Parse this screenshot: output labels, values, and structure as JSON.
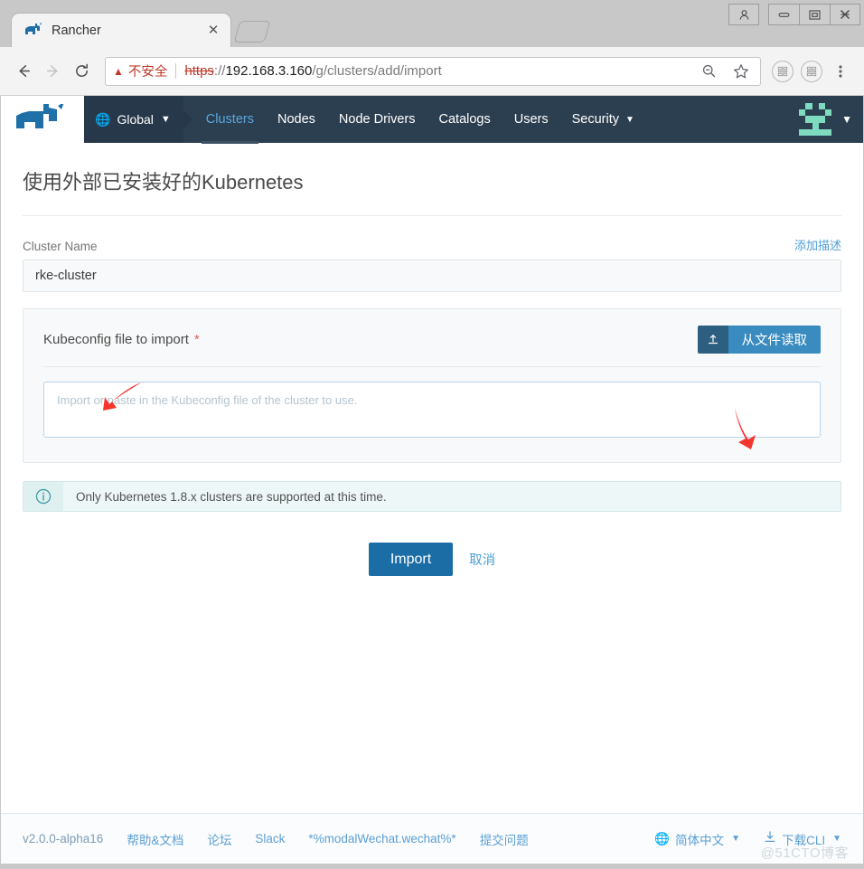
{
  "browser": {
    "tab": {
      "title": "Rancher",
      "favicon_icon": "rancher-favicon",
      "close_icon": "close-icon"
    },
    "new_tab_icon": "new-tab-icon",
    "window_controls": {
      "profile_icon": "person-icon",
      "minimize_icon": "minimize-icon",
      "maximize_icon": "maximize-icon",
      "close_icon": "window-close-icon"
    },
    "toolbar": {
      "back_icon": "back-arrow-icon",
      "forward_icon": "forward-arrow-icon",
      "reload_icon": "reload-icon",
      "security_warning_icon": "warning-triangle-icon",
      "security_warning_text": "不安全",
      "url_scheme": "https",
      "url_scheme_suffix": "://",
      "url_host": "192.168.3.160",
      "url_path": "/g/clusters/add/import",
      "zoom_icon": "zoom-out-icon",
      "bookmark_icon": "star-icon",
      "extension_1_icon": "extension-icon",
      "extension_2_icon": "extension-icon",
      "menu_icon": "three-dot-menu-icon"
    }
  },
  "nav": {
    "logo_icon": "rancher-cow-logo",
    "context": {
      "globe_icon": "globe-icon",
      "label": "Global",
      "caret_icon": "chevron-down-icon"
    },
    "links": [
      {
        "label": "Clusters",
        "active": true
      },
      {
        "label": "Nodes",
        "active": false
      },
      {
        "label": "Node Drivers",
        "active": false
      },
      {
        "label": "Catalogs",
        "active": false
      },
      {
        "label": "Users",
        "active": false
      },
      {
        "label": "Security",
        "active": false,
        "caret_icon": "chevron-down-icon"
      }
    ],
    "avatar_icon": "user-avatar-identicon",
    "avatar_caret_icon": "chevron-down-icon"
  },
  "main": {
    "title": "使用外部已安装好的Kubernetes",
    "cluster_name": {
      "label": "Cluster Name",
      "value": "rke-cluster",
      "placeholder": "",
      "add_description_link": "添加描述"
    },
    "kubeconfig": {
      "label": "Kubeconfig file to import",
      "required_marker": "*",
      "upload_button": {
        "icon": "upload-icon",
        "label": "从文件读取"
      },
      "textarea_value": "",
      "textarea_placeholder": "Import or paste in the Kubeconfig file of the cluster to use."
    },
    "banner": {
      "icon": "info-circle-icon",
      "text": "Only Kubernetes 1.8.x clusters are supported at this time."
    },
    "actions": {
      "primary": "Import",
      "cancel": "取消"
    }
  },
  "footer": {
    "version": "v2.0.0-alpha16",
    "links": [
      "帮助&文档",
      "论坛",
      "Slack",
      "*%modalWechat.wechat%*",
      "提交问题"
    ],
    "language": {
      "icon": "globe-icon",
      "label": "简体中文",
      "caret_icon": "chevron-down-icon"
    },
    "download_cli": {
      "icon": "download-icon",
      "label": "下载CLI",
      "caret_icon": "chevron-down-icon"
    },
    "watermark": "@51CTO博客"
  },
  "colors": {
    "nav_dark": "#2c3f51",
    "accent_blue": "#1b6ea5",
    "link_blue": "#4c9fd5",
    "active_tab_blue": "#5ba7d9",
    "upload_btn_light": "#3a8bc0",
    "upload_btn_dark": "#2d5f80",
    "banner_bg": "#eef7f8",
    "avatar_green": "#7fdbc0",
    "warning_red": "#c0392b",
    "annotation_red": "#f4342e"
  }
}
